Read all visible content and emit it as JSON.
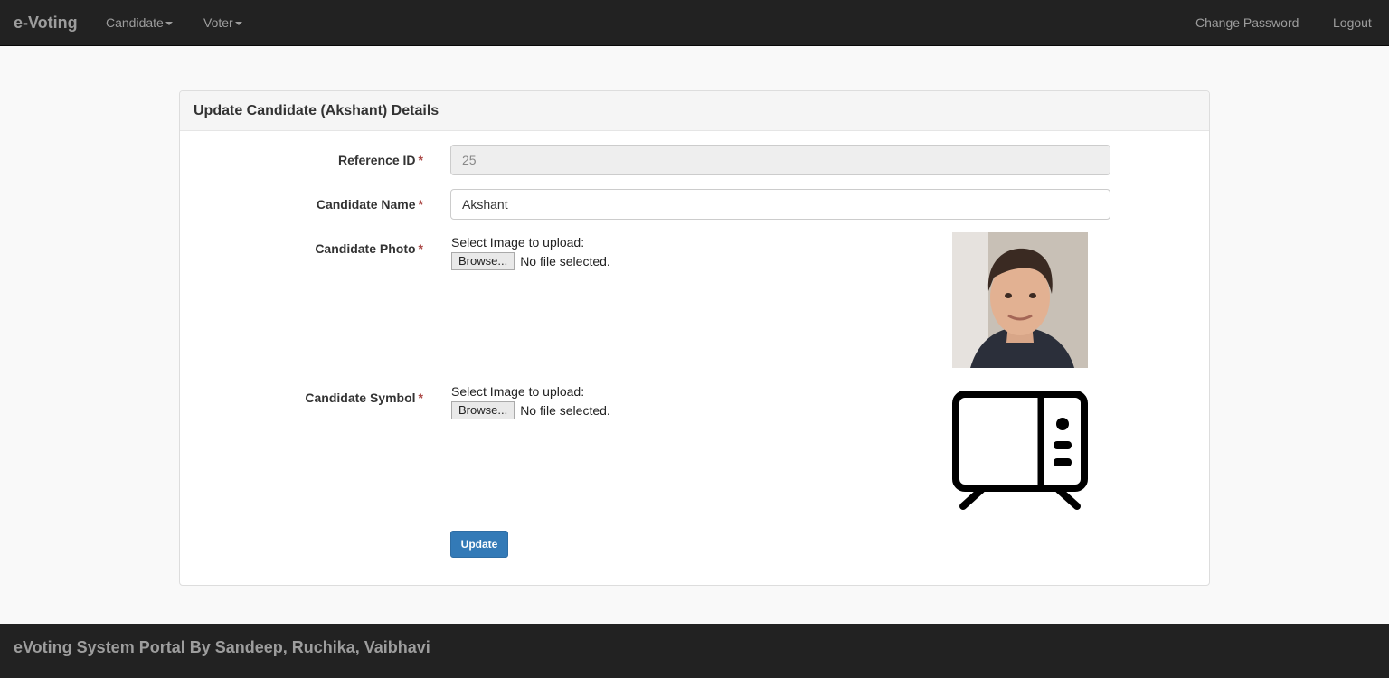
{
  "navbar": {
    "brand": "e-Voting",
    "items": [
      {
        "label": "Candidate",
        "dropdown": true
      },
      {
        "label": "Voter",
        "dropdown": true
      }
    ],
    "right_items": [
      {
        "label": "Change Password"
      },
      {
        "label": "Logout"
      }
    ]
  },
  "panel": {
    "title": "Update Candidate (Akshant) Details"
  },
  "form": {
    "reference_id": {
      "label": "Reference ID",
      "required_mark": "*",
      "value": "25"
    },
    "candidate_name": {
      "label": "Candidate Name",
      "required_mark": "*",
      "value": "Akshant"
    },
    "candidate_photo": {
      "label": "Candidate Photo",
      "required_mark": "*",
      "upload_prompt": "Select Image to upload:",
      "browse_label": "Browse...",
      "file_status": "No file selected."
    },
    "candidate_symbol": {
      "label": "Candidate Symbol",
      "required_mark": "*",
      "upload_prompt": "Select Image to upload:",
      "browse_label": "Browse...",
      "file_status": "No file selected.",
      "symbol_icon": "television-icon"
    },
    "submit_label": "Update"
  },
  "footer": {
    "text": "eVoting System Portal By Sandeep, Ruchika, Vaibhavi"
  },
  "colors": {
    "navbar_bg": "#222222",
    "nav_text": "#9d9d9d",
    "primary_button": "#337ab7",
    "required": "#a94442"
  }
}
